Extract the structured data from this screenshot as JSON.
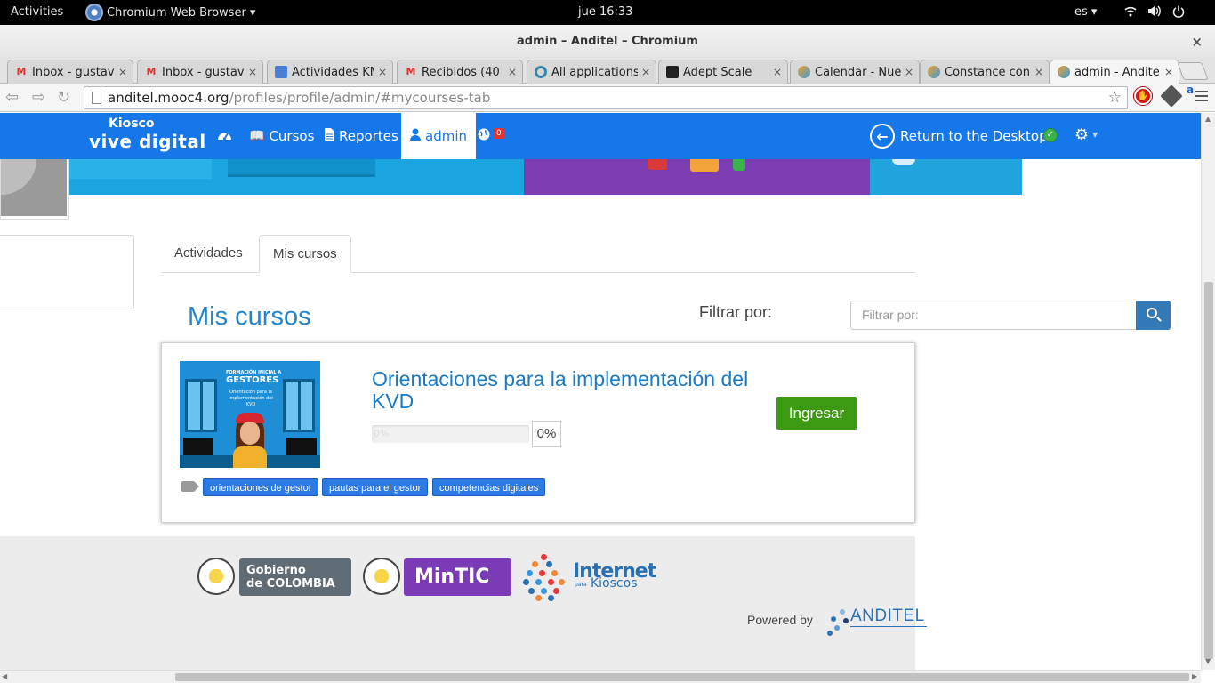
{
  "system_bar": {
    "activities": "Activities",
    "app_menu": "Chromium Web Browser ▾",
    "clock": "jue 16:33",
    "language": "es ▾"
  },
  "window": {
    "title": "admin – Anditel – Chromium",
    "close": "×"
  },
  "tabs": [
    {
      "title": "Inbox - gustav",
      "icon": "gmail-icon",
      "close": "×"
    },
    {
      "title": "Inbox - gustav",
      "icon": "gmail-icon",
      "close": "×"
    },
    {
      "title": "Actividades KM",
      "icon": "docs-icon",
      "close": "×"
    },
    {
      "title": "Recibidos (40",
      "icon": "gmail-icon",
      "close": "×"
    },
    {
      "title": "All applications",
      "icon": "ring-icon",
      "close": "×"
    },
    {
      "title": "Adept Scale",
      "icon": "adept-icon",
      "close": "×"
    },
    {
      "title": "Calendar - Nue",
      "icon": "moodle-icon",
      "close": "×"
    },
    {
      "title": "Constance con",
      "icon": "moodle-icon",
      "close": "×"
    },
    {
      "title": "admin - Andite",
      "icon": "moodle-icon",
      "close": "×"
    }
  ],
  "omnibox": {
    "host": "anditel.mooc4.org",
    "path": "/profiles/profile/admin/#mycourses-tab"
  },
  "site_nav": {
    "brand_top": "Kiosco",
    "brand_bottom": "vive digital",
    "items": [
      {
        "label": ""
      },
      {
        "label": "Cursos"
      },
      {
        "label": "Reportes"
      },
      {
        "label": "admin"
      }
    ],
    "notifications_count": "0",
    "return_label": "Return to the Desktop"
  },
  "profile_tabs": [
    {
      "label": "Actividades",
      "active": false
    },
    {
      "label": "Mis cursos",
      "active": true
    }
  ],
  "section_title": "Mis cursos",
  "filter": {
    "label": "Filtrar por:",
    "placeholder": "Filtrar por:"
  },
  "course": {
    "title": "Orientaciones para la implementación del KVD",
    "progress_percent": 0,
    "progress_bar_label": "0%",
    "progress_label": "0%",
    "enter_label": "Ingresar",
    "thumbnail": {
      "line1": "FORMACIÓN INICIAL A",
      "line2": "GESTORES",
      "sub": "Orientación para la implementación del KVD"
    },
    "tags": [
      "orientaciones de gestor",
      "pautas para el gestor",
      "competencias digitales"
    ]
  },
  "footer": {
    "gov_line1": "Gobierno",
    "gov_line2": "de COLOMBIA",
    "mintic": "MinTIC",
    "ik_word": "Internet",
    "ik_para": "para",
    "ik_kioscos": "Kioscos",
    "powered_by": "Powered by",
    "anditel": "ANDITEL"
  },
  "colors": {
    "nav_blue": "#1677e9",
    "link_blue": "#1a7ac6",
    "enter_green": "#3c9a12",
    "tag_blue": "#2c7be5"
  }
}
